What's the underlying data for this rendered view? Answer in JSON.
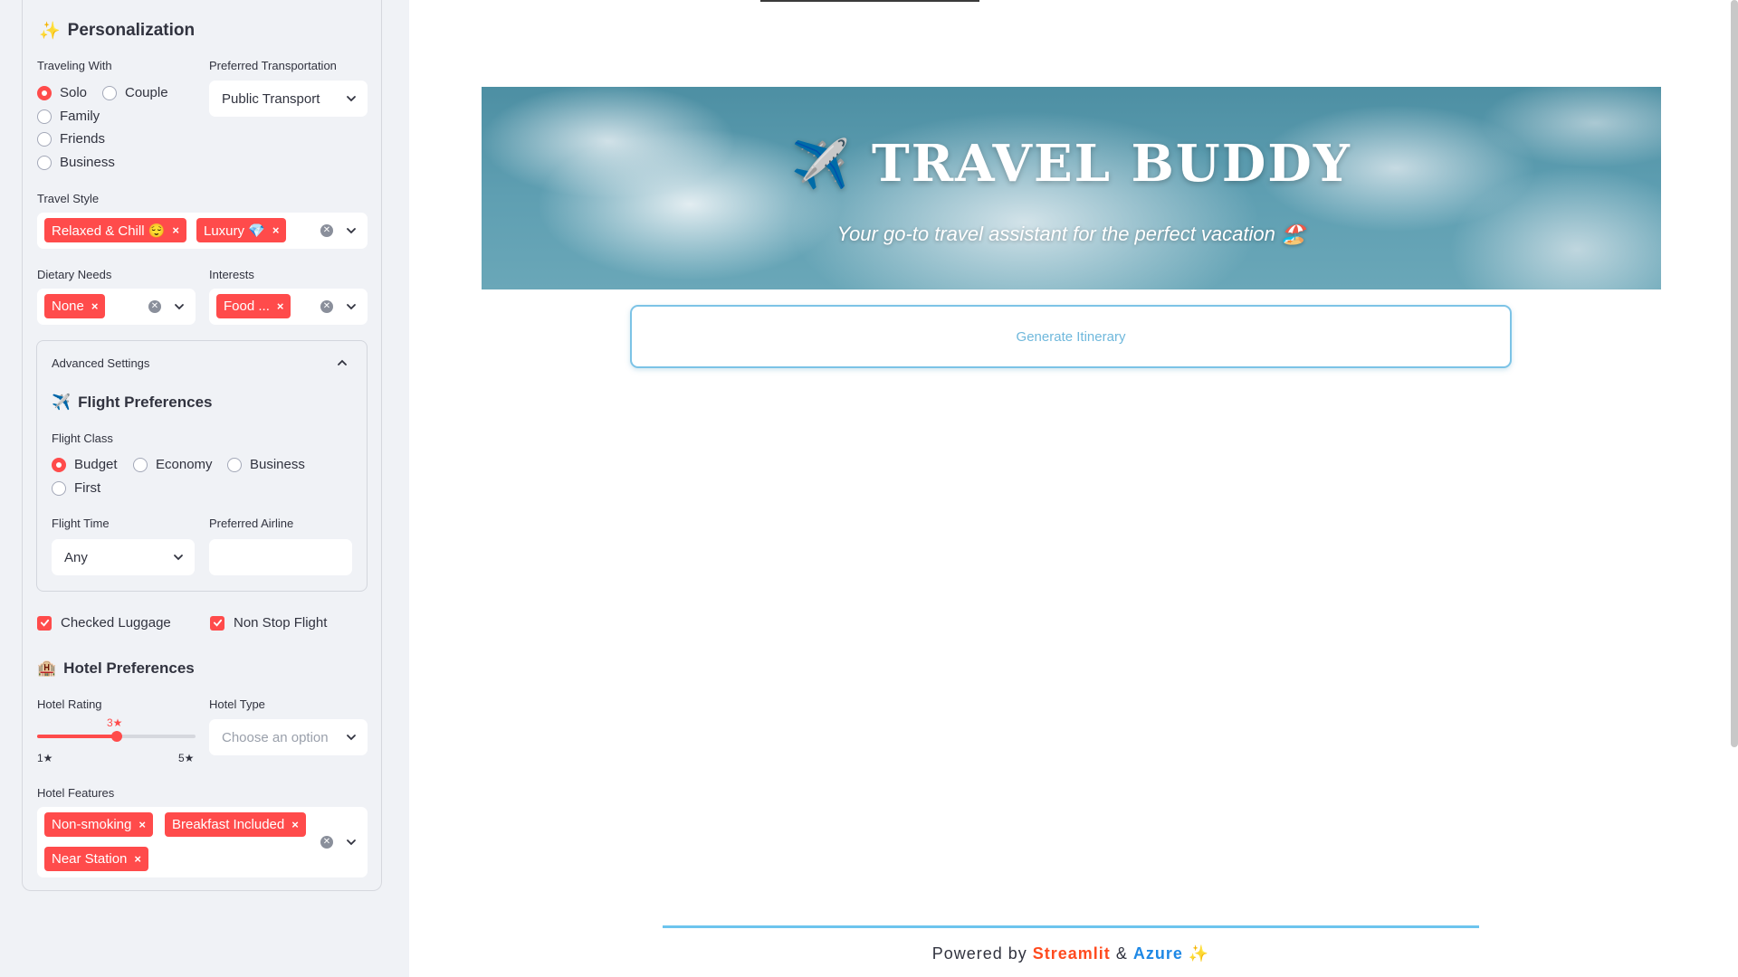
{
  "sidebar": {
    "personalization": {
      "icon": "✨",
      "title": "Personalization"
    },
    "traveling_with": {
      "label": "Traveling With",
      "options": [
        "Solo",
        "Couple",
        "Family",
        "Friends",
        "Business"
      ],
      "selected": "Solo"
    },
    "transportation": {
      "label": "Preferred Transportation",
      "value": "Public Transport"
    },
    "travel_style": {
      "label": "Travel Style",
      "tags": [
        "Relaxed & Chill 😌",
        "Luxury 💎"
      ]
    },
    "dietary": {
      "label": "Dietary Needs",
      "tags": [
        "None"
      ]
    },
    "interests": {
      "label": "Interests",
      "tags": [
        "Food ..."
      ]
    },
    "advanced": {
      "title": "Advanced Settings",
      "flight_prefs": {
        "icon": "✈️",
        "title": "Flight Preferences"
      },
      "flight_class": {
        "label": "Flight Class",
        "options": [
          "Budget",
          "Economy",
          "Business",
          "First"
        ],
        "selected": "Budget"
      },
      "flight_time": {
        "label": "Flight Time",
        "value": "Any"
      },
      "airline": {
        "label": "Preferred Airline",
        "value": ""
      }
    },
    "checked_luggage": {
      "label": "Checked Luggage",
      "checked": true
    },
    "non_stop": {
      "label": "Non Stop Flight",
      "checked": true
    },
    "hotel_prefs": {
      "icon": "🏨",
      "title": "Hotel Preferences"
    },
    "hotel_rating": {
      "label": "Hotel Rating",
      "value_label": "3★",
      "min_label": "1★",
      "max_label": "5★",
      "value": 3,
      "min": 1,
      "max": 5
    },
    "hotel_type": {
      "label": "Hotel Type",
      "placeholder": "Choose an option"
    },
    "hotel_features": {
      "label": "Hotel Features",
      "tags": [
        "Non-smoking",
        "Breakfast Included",
        "Near Station"
      ]
    }
  },
  "hero": {
    "icon": "✈️",
    "title": "TRAVEL BUDDY",
    "subtitle": "Your go-to travel assistant for the perfect vacation 🏖️"
  },
  "main": {
    "generate_button": "Generate Itinerary"
  },
  "footer": {
    "prefix": "Powered by",
    "streamlit": "Streamlit",
    "amp": "&",
    "azure": "Azure",
    "sparkle": "✨"
  },
  "colors": {
    "accent": "#ff4b4b",
    "button_border": "#7cc3e6",
    "footer_line": "#6cc4ee",
    "azure": "#1e88e5",
    "streamlit": "#ff4b1f"
  }
}
